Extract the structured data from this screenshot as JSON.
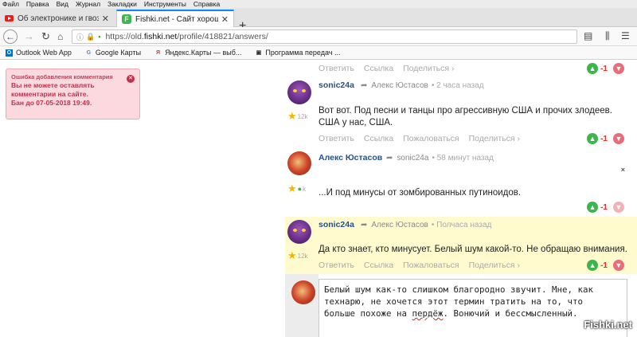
{
  "menubar": [
    "Файл",
    "Правка",
    "Вид",
    "Журнал",
    "Закладки",
    "Инструменты",
    "Справка"
  ],
  "tabs": [
    {
      "title": "Об электронике и гвоздях госу",
      "close": "✕"
    },
    {
      "title": "Fishki.net - Сайт хорошего на",
      "close": "✕"
    }
  ],
  "newtab": "+",
  "url": {
    "scheme_host": "https://old.",
    "domain": "fishki.net",
    "path": "/profile/418821/answers/"
  },
  "bookmarks": [
    {
      "label": "Outlook Web App",
      "color": "#0072c6",
      "icon": "O"
    },
    {
      "label": "Google Карты",
      "color": "#4285f4",
      "icon": "G"
    },
    {
      "label": "Яндекс.Карты — выб...",
      "color": "#e23b2e",
      "icon": "Я"
    },
    {
      "label": "Программа передач ...",
      "color": "#333333",
      "icon": "▣"
    }
  ],
  "error": {
    "title": "Ошибка добавления комментария",
    "line1": "Вы не можете оставлять",
    "line2": "комментарии на сайте.",
    "line3": "Бан до 07-05-2018 19:49.",
    "close": "✕"
  },
  "top_actions": {
    "reply": "Ответить",
    "link": "Ссылка",
    "share": "Поделиться ›",
    "score": "-1"
  },
  "comments": [
    {
      "author": "sonic24a",
      "reply_to": "Алекс Юстасов",
      "time": "2 часа назад",
      "rank": "12k",
      "text": "Вот вот. Под песни и танцы про агрессивную США и прочих злодеев. США у нас, США.",
      "actions": [
        "Ответить",
        "Ссылка",
        "Пожаловаться",
        "Поделиться ›"
      ],
      "score": "-1"
    },
    {
      "author": "Алекс Юстасов",
      "reply_to": "sonic24a",
      "time": "58 минут назад",
      "rank": "k",
      "text": "...И под минусы от зомбированных путиноидов.",
      "score": "-1",
      "close": "×"
    },
    {
      "author": "sonic24a",
      "reply_to": "Алекс Юстасов",
      "time": "Полчаса назад",
      "rank": "12k",
      "text": "Да кто знает, кто минусует. Белый шум какой-то. Не обращаю внимания.",
      "actions": [
        "Ответить",
        "Ссылка",
        "Пожаловаться",
        "Поделиться ›"
      ],
      "score": "-1"
    }
  ],
  "editor": {
    "line1": "Белый шум как-то слишком благородно звучит. Мне, как",
    "line2": "технарю, не хочется этот термин тратить на то, что",
    "line3a": "больше похоже на ",
    "line3b": "пердёж",
    "line3c": ". Вонючий и бессмысленный."
  },
  "watermark": "Fishki.net"
}
